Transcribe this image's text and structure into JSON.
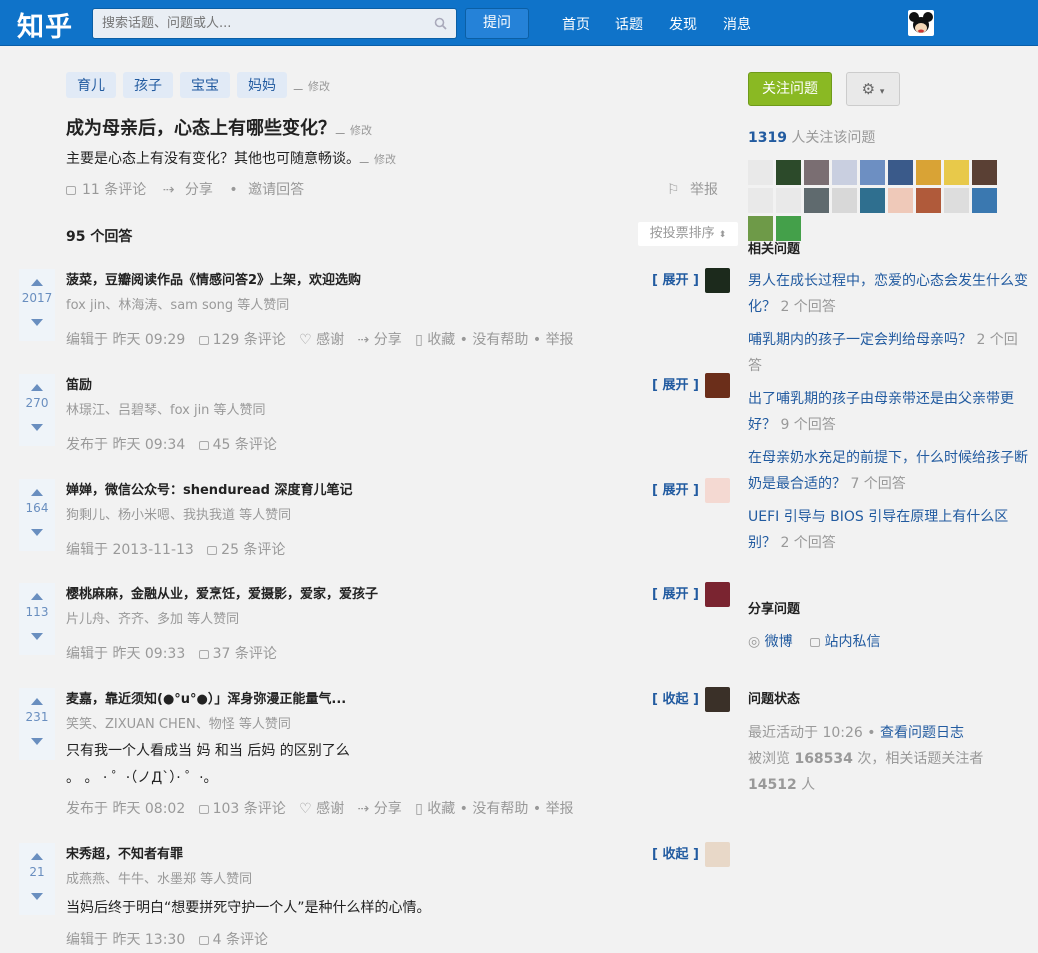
{
  "topbar": {
    "logo": "知乎",
    "search_placeholder": "搜索话题、问题或人...",
    "ask_label": "提问",
    "nav": [
      "首页",
      "话题",
      "发现",
      "消息"
    ]
  },
  "question": {
    "tags": [
      "育儿",
      "孩子",
      "宝宝",
      "妈妈"
    ],
    "edit_label": "修改",
    "title": "成为母亲后，心态上有哪些变化？",
    "description": "主要是心态上有没有变化？其他也可随意畅谈。",
    "comments": "11 条评论",
    "share": "分享",
    "invite": "邀请回答",
    "report": "举报",
    "answer_count": "95 个回答",
    "sort_label": "按投票排序"
  },
  "answers": [
    {
      "votes": "2017",
      "author": "菠菜，豆瓣阅读作品《情感问答2》上架，欢迎选购",
      "voters": "fox jin、林海涛、sam song 等人赞同",
      "toggle": "[ 展开 ]",
      "content": [],
      "meta": [
        "编辑于 昨天 09:29",
        "129 条评论",
        "感谢",
        "分享",
        "收藏",
        "没有帮助",
        "举报"
      ]
    },
    {
      "votes": "270",
      "author": "笛励",
      "voters": "林璟江、吕碧琴、fox jin 等人赞同",
      "toggle": "[ 展开 ]",
      "content": [],
      "meta": [
        "发布于 昨天 09:34",
        "45 条评论"
      ]
    },
    {
      "votes": "164",
      "author": "婵婵，微信公众号：shenduread 深度育儿笔记",
      "voters": "狗剩儿、杨小米嗯、我执我道 等人赞同",
      "toggle": "[ 展开 ]",
      "content": [],
      "meta": [
        "编辑于 2013-11-13",
        "25 条评论"
      ]
    },
    {
      "votes": "113",
      "author": "樱桃麻麻，金融从业，爱烹饪，爱摄影，爱家，爱孩子",
      "voters": "片儿舟、齐齐、多加 等人赞同",
      "toggle": "[ 展开 ]",
      "content": [],
      "meta": [
        "编辑于 昨天 09:33",
        "37 条评论"
      ]
    },
    {
      "votes": "231",
      "author": "麦嘉，靠近须知(●°u°●）」浑身弥漫正能量气...",
      "voters": "笑笑、ZIXUAN CHEN、物怪 等人赞同",
      "toggle": "[ 收起 ]",
      "content": [
        "只有我一个人看成当 妈 和当 后妈 的区别了么",
        "。 。 · ゜·（ノД`）· ゜·。"
      ],
      "meta": [
        "发布于 昨天 08:02",
        "103 条评论",
        "感谢",
        "分享",
        "收藏",
        "没有帮助",
        "举报"
      ]
    },
    {
      "votes": "21",
      "author": "宋秀超，不知者有罪",
      "voters": "成燕燕、牛牛、水墨郑 等人赞同",
      "toggle": "[ 收起 ]",
      "content": [
        "当妈后终于明白“想要拼死守护一个人”是种什么样的心情。"
      ],
      "meta": [
        "编辑于 昨天 13:30",
        "4 条评论"
      ]
    }
  ],
  "sidebar": {
    "follow_label": "关注问题",
    "followers_count": "1319",
    "followers_text": "人关注该问题",
    "related_heading": "相关问题",
    "related": [
      {
        "title": "男人在成长过程中，恋爱的心态会发生什么变化？",
        "count": "2 个回答"
      },
      {
        "title": "哺乳期内的孩子一定会判给母亲吗？",
        "count": "2 个回答"
      },
      {
        "title": "出了哺乳期的孩子由母亲带还是由父亲带更好？",
        "count": "9 个回答"
      },
      {
        "title": "在母亲奶水充足的前提下，什么时候给孩子断奶是最合适的？",
        "count": "7 个回答"
      },
      {
        "title": "UEFI 引导与 BIOS 引导在原理上有什么区别？",
        "count": "2 个回答"
      }
    ],
    "share_heading": "分享问题",
    "share_weibo": "微博",
    "share_pm": "站内私信",
    "status_heading": "问题状态",
    "last_active": "最近活动于 10:26",
    "view_log": "查看问题日志",
    "views_prefix": "被浏览",
    "views": "168534",
    "views_suffix": "次，相关话题关注者",
    "topic_followers": "14512",
    "topic_followers_suffix": "人"
  }
}
